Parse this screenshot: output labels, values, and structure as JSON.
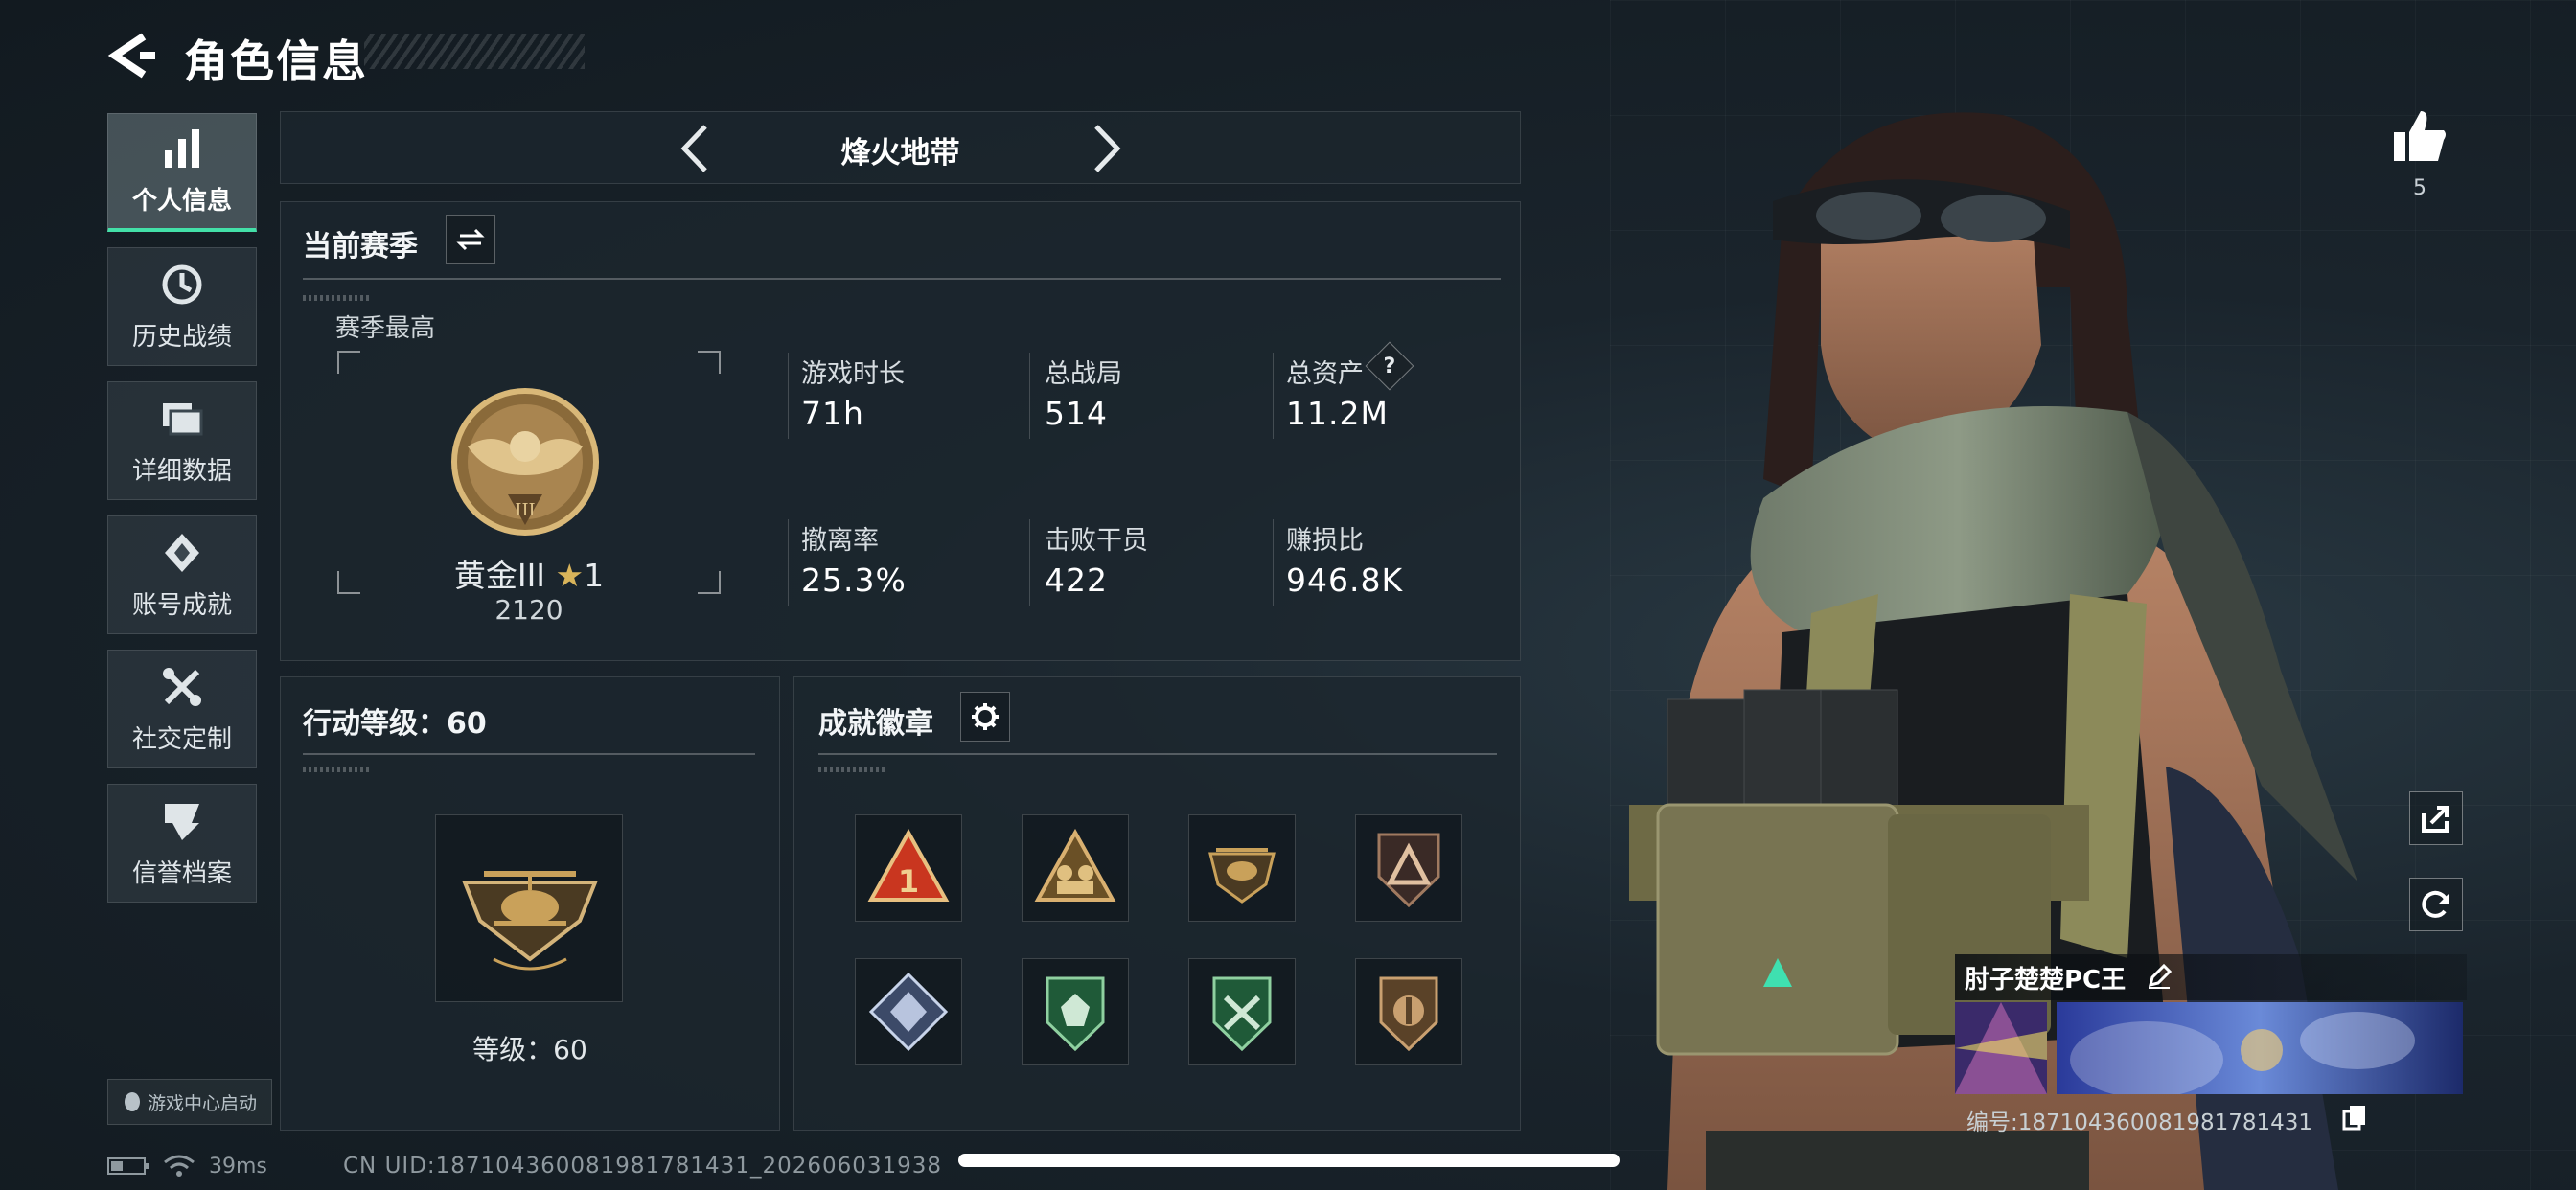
{
  "header": {
    "title": "角色信息"
  },
  "sidebar": {
    "items": [
      {
        "label": "个人信息",
        "icon": "bar-chart-icon",
        "active": true
      },
      {
        "label": "历史战绩",
        "icon": "history-clock-icon",
        "active": false
      },
      {
        "label": "详细数据",
        "icon": "folder-stack-icon",
        "active": false
      },
      {
        "label": "账号成就",
        "icon": "achievement-medal-icon",
        "active": false
      },
      {
        "label": "社交定制",
        "icon": "wrench-tools-icon",
        "active": false
      },
      {
        "label": "信誉档案",
        "icon": "credit-shield-icon",
        "active": false
      }
    ],
    "launch_label": "游戏中心启动"
  },
  "mode": {
    "name": "烽火地带"
  },
  "season": {
    "title": "当前赛季",
    "best_label": "赛季最高",
    "rank_name": "黄金III",
    "rank_stars": "1",
    "rank_score": "2120",
    "stats": [
      {
        "label": "游戏时长",
        "value": "71h"
      },
      {
        "label": "总战局",
        "value": "514"
      },
      {
        "label": "总资产",
        "value": "11.2M",
        "has_help": true
      },
      {
        "label": "撤离率",
        "value": "25.3%"
      },
      {
        "label": "击败干员",
        "value": "422"
      },
      {
        "label": "赚损比",
        "value": "946.8K"
      }
    ],
    "help_glyph": "?"
  },
  "action_level": {
    "title": "行动等级：60",
    "level_text": "等级：60"
  },
  "badges": {
    "title": "成就徽章",
    "items": [
      {
        "icon": "badge-red-triangle-1-icon",
        "color": "#c9361f"
      },
      {
        "icon": "badge-soldiers-triangle-icon",
        "color": "#b8954a"
      },
      {
        "icon": "badge-helicopter-icon",
        "color": "#a88a55"
      },
      {
        "icon": "badge-red-triangle-shield-icon",
        "color": "#8a3a2e"
      },
      {
        "icon": "badge-blue-diamond-icon",
        "color": "#8aa0c8"
      },
      {
        "icon": "badge-green-shield-icon",
        "color": "#2f8a55"
      },
      {
        "icon": "badge-green-crossed-icon",
        "color": "#2f8a55"
      },
      {
        "icon": "badge-bronze-shield-icon",
        "color": "#9a7448"
      }
    ]
  },
  "profile": {
    "likes": "5",
    "player_name": "肘子楚楚PC王",
    "player_id": "编号:18710436008198178143​1"
  },
  "footer": {
    "ping": "39ms",
    "uid_line": "CN UID:18710436008198178143​1_202606031938"
  },
  "colors": {
    "accent": "#43e0a8",
    "gold": "#c9a15a"
  }
}
